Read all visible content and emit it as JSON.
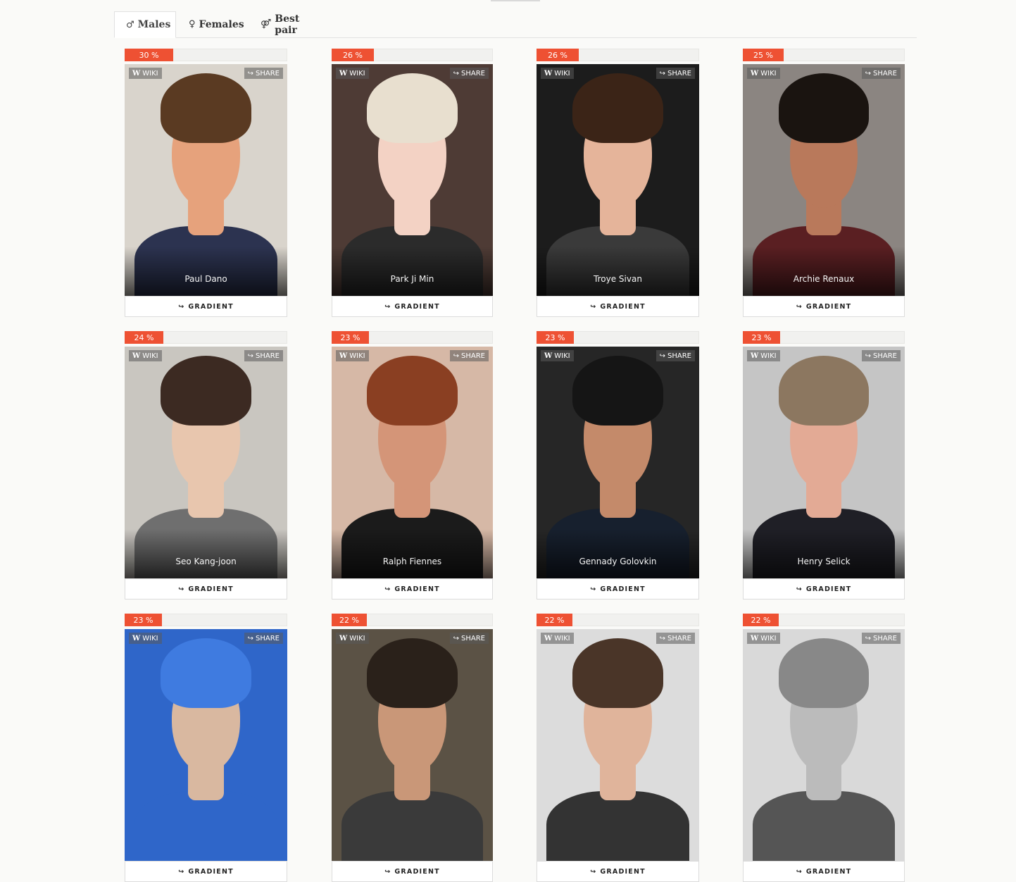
{
  "tabs": [
    {
      "icon": "♂",
      "label": "Males",
      "active": true
    },
    {
      "icon": "♀",
      "label": "Females",
      "active": false
    },
    {
      "icon": "⚤",
      "label": "Best pair",
      "active": false
    }
  ],
  "card_labels": {
    "wiki": "WIKI",
    "share": "SHARE",
    "gradient": "GRADIENT"
  },
  "icons": {
    "wiki": "wikipedia-icon",
    "share": "share-icon",
    "gradient": "share-icon"
  },
  "colors": {
    "percent_bar": "#ee5133",
    "bar_track": "#f1f1ef",
    "tab_border": "#e1e1e1"
  },
  "cards": [
    {
      "name": "Paul Dano",
      "percent": "30 %",
      "value": 30,
      "palette": {
        "bg": "#d9d4cc",
        "hair": "#5a3a22",
        "skin": "#e6a27c",
        "torso": "#2c3350"
      }
    },
    {
      "name": "Park Ji Min",
      "percent": "26 %",
      "value": 26,
      "palette": {
        "bg": "#4e3b35",
        "hair": "#e8dfcf",
        "skin": "#f3d2c4",
        "torso": "#2b2b2b"
      }
    },
    {
      "name": "Troye Sivan",
      "percent": "26 %",
      "value": 26,
      "palette": {
        "bg": "#1c1c1c",
        "hair": "#3b2417",
        "skin": "#e5b49a",
        "torso": "#3a3a3a"
      }
    },
    {
      "name": "Archie Renaux",
      "percent": "25 %",
      "value": 25,
      "palette": {
        "bg": "#8b8581",
        "hair": "#1a1410",
        "skin": "#b9795b",
        "torso": "#5a1f22"
      }
    },
    {
      "name": "Seo Kang-joon",
      "percent": "24 %",
      "value": 24,
      "palette": {
        "bg": "#c9c6c0",
        "hair": "#3c2a22",
        "skin": "#e8c6ae",
        "torso": "#6f6f6f"
      }
    },
    {
      "name": "Ralph Fiennes",
      "percent": "23 %",
      "value": 23,
      "palette": {
        "bg": "#d6b8a6",
        "hair": "#8a3f22",
        "skin": "#d49578",
        "torso": "#1b1b1b"
      }
    },
    {
      "name": "Gennady Golovkin",
      "percent": "23 %",
      "value": 23,
      "palette": {
        "bg": "#262626",
        "hair": "#151515",
        "skin": "#c48a6a",
        "torso": "#17202e"
      }
    },
    {
      "name": "Henry Selick",
      "percent": "23 %",
      "value": 23,
      "palette": {
        "bg": "#c5c5c5",
        "hair": "#8c7760",
        "skin": "#e3aa95",
        "torso": "#1f1f26"
      }
    },
    {
      "name": "",
      "percent": "23 %",
      "value": 23,
      "palette": {
        "bg": "#2f66c9",
        "hair": "#3f7be0",
        "skin": "#d9b8a0",
        "torso": "#2f66c9"
      }
    },
    {
      "name": "",
      "percent": "22 %",
      "value": 22,
      "palette": {
        "bg": "#5b5245",
        "hair": "#2a211a",
        "skin": "#c99778",
        "torso": "#3a3a3a"
      }
    },
    {
      "name": "",
      "percent": "22 %",
      "value": 22,
      "palette": {
        "bg": "#dcdcdc",
        "hair": "#4a3528",
        "skin": "#e0b49b",
        "torso": "#333333"
      }
    },
    {
      "name": "",
      "percent": "22 %",
      "value": 22,
      "palette": {
        "bg": "#d9d9d9",
        "hair": "#888888",
        "skin": "#bbbbbb",
        "torso": "#555555"
      }
    }
  ]
}
